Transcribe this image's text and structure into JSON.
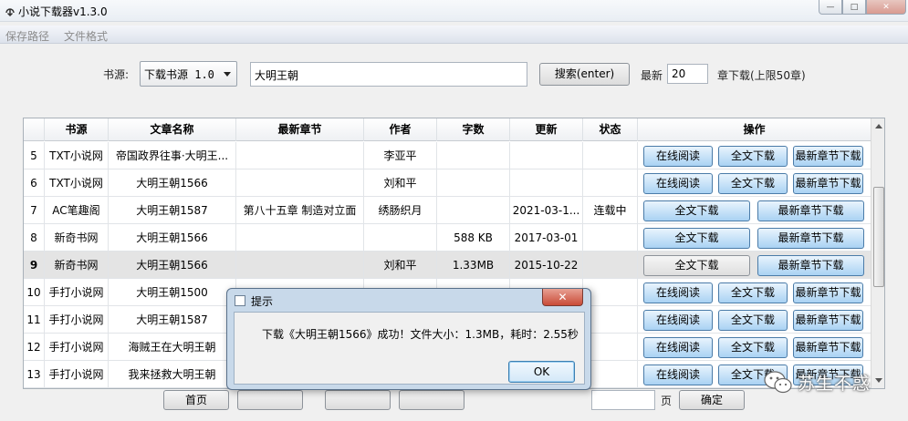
{
  "window": {
    "title": "小说下载器v1.3.0",
    "minimize": "—",
    "maximize": "□",
    "close": "✕"
  },
  "menu": [
    "保存路径",
    "文件格式"
  ],
  "search": {
    "source_label": "书源:",
    "source_value": "下载书源 1.0",
    "keyword": "大明王朝",
    "search_button": "搜索(enter)",
    "latest_label": "最新",
    "latest_count": "20",
    "latest_suffix": "章下载(上限50章)"
  },
  "table": {
    "columns": [
      "",
      "书源",
      "文章名称",
      "最新章节",
      "作者",
      "字数",
      "更新",
      "状态",
      "操作"
    ],
    "selected_row": "9",
    "rows": [
      {
        "num": "5",
        "source": "TXT小说网",
        "name": "帝国政界往事·大明王...",
        "latest": "",
        "author": "李亚平",
        "words": "",
        "updated": "",
        "status": "",
        "actions": [
          "在线阅读",
          "全文下载",
          "最新章节下载"
        ]
      },
      {
        "num": "6",
        "source": "TXT小说网",
        "name": "大明王朝1566",
        "latest": "",
        "author": "刘和平",
        "words": "",
        "updated": "",
        "status": "",
        "actions": [
          "在线阅读",
          "全文下载",
          "最新章节下载"
        ]
      },
      {
        "num": "7",
        "source": "AC笔趣阁",
        "name": "大明王朝1587",
        "latest": "第八十五章 制造对立面",
        "author": "绣肠织月",
        "words": "",
        "updated": "2021-03-1...",
        "status": "连载中",
        "actions": [
          "全文下载",
          "最新章节下载"
        ]
      },
      {
        "num": "8",
        "source": "新奇书网",
        "name": "大明王朝1566",
        "latest": "",
        "author": "",
        "words": "588 KB",
        "updated": "2017-03-01",
        "status": "",
        "actions": [
          "全文下载",
          "最新章节下载"
        ]
      },
      {
        "num": "9",
        "source": "新奇书网",
        "name": "大明王朝1566",
        "latest": "",
        "author": "刘和平",
        "words": "1.33MB",
        "updated": "2015-10-22",
        "status": "",
        "actions": [
          "全文下载",
          "最新章节下载"
        ]
      },
      {
        "num": "10",
        "source": "手打小说网",
        "name": "大明王朝1500",
        "latest": "",
        "author": "",
        "words": "",
        "updated": "",
        "status": "",
        "actions": [
          "在线阅读",
          "全文下载",
          "最新章节下载"
        ]
      },
      {
        "num": "11",
        "source": "手打小说网",
        "name": "大明王朝1587",
        "latest": "",
        "author": "",
        "words": "",
        "updated": "",
        "status": "",
        "actions": [
          "在线阅读",
          "全文下载",
          "最新章节下载"
        ]
      },
      {
        "num": "12",
        "source": "手打小说网",
        "name": "海贼王在大明王朝",
        "latest": "",
        "author": "",
        "words": "",
        "updated": "",
        "status": "",
        "actions": [
          "在线阅读",
          "全文下载",
          "最新章节下载"
        ]
      },
      {
        "num": "13",
        "source": "手打小说网",
        "name": "我来拯救大明王朝",
        "latest": "",
        "author": "",
        "words": "",
        "updated": "",
        "status": "",
        "actions": [
          "在线阅读",
          "全文下载",
          "最新章节下载"
        ]
      }
    ]
  },
  "pagination": {
    "first": "首页",
    "page_suffix": "页",
    "confirm": "确定"
  },
  "dialog": {
    "title": "提示",
    "message": "下载《大明王朝1566》成功！文件大小：1.3MB，耗时：2.55秒",
    "ok": "OK",
    "close": "✕"
  },
  "watermark": {
    "text": "苏生不惑"
  },
  "colors": {
    "action_button": "#a9d2f3",
    "dialog_frame": "#c8d9ea",
    "close_red": "#c94b37"
  }
}
